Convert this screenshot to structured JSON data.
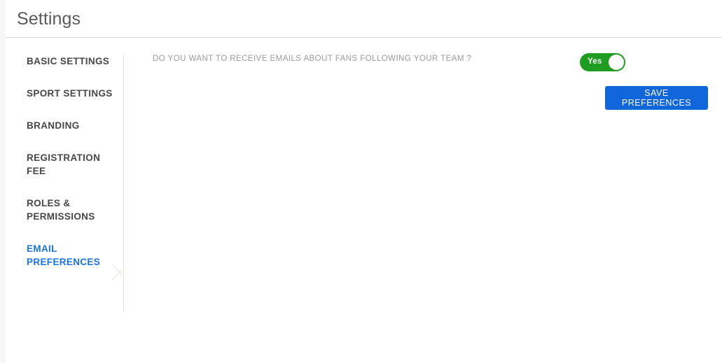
{
  "header": {
    "title": "Settings"
  },
  "sidebar": {
    "items": [
      {
        "label": "BASIC SETTINGS",
        "active": false
      },
      {
        "label": "SPORT SETTINGS",
        "active": false
      },
      {
        "label": "BRANDING",
        "active": false
      },
      {
        "label": "REGISTRATION FEE",
        "active": false
      },
      {
        "label": "ROLES & PERMISSIONS",
        "active": false
      },
      {
        "label": "EMAIL PREFERENCES",
        "active": true
      }
    ]
  },
  "main": {
    "preference": {
      "question": "DO YOU WANT TO RECEIVE EMAILS ABOUT FANS FOLLOWING YOUR TEAM ?",
      "toggle_value": "Yes",
      "toggle_state": "on",
      "toggle_on_color": "#1f9d20"
    },
    "save_label": "SAVE PREFERENCES",
    "save_color": "#1266dc"
  },
  "colors": {
    "accent_blue": "#1a73e8",
    "nav_text": "#474747",
    "label_text": "#9b9b9b",
    "divider": "#efe2d7"
  }
}
